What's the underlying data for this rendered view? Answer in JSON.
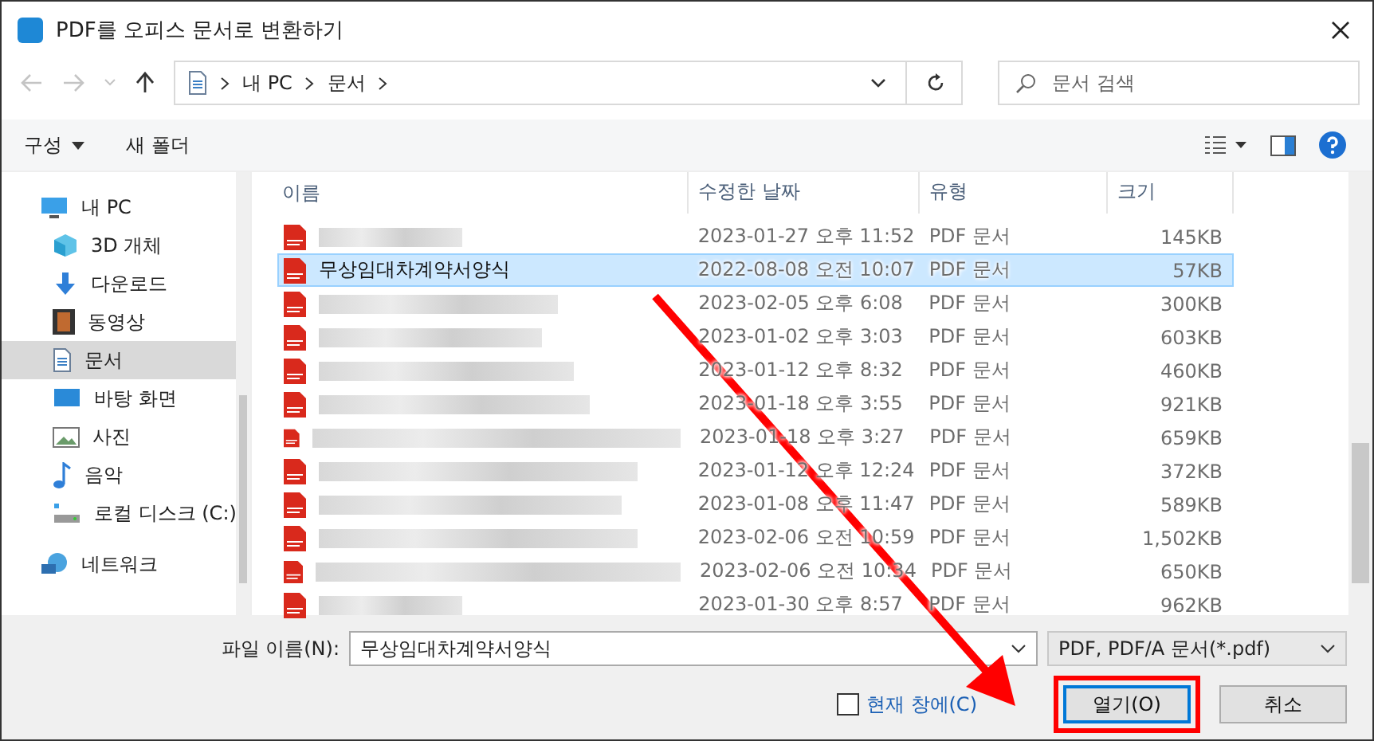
{
  "window": {
    "title": "PDF를 오피스 문서로 변환하기"
  },
  "nav": {
    "path": [
      "내 PC",
      "문서"
    ],
    "search_placeholder": "문서 검색"
  },
  "toolbar": {
    "organize": "구성",
    "new_folder": "새 폴더"
  },
  "sidebar": {
    "items": [
      {
        "label": "내 PC",
        "kind": "pc",
        "selected": false,
        "children": [
          {
            "label": "3D 개체",
            "kind": "cube",
            "selected": false
          },
          {
            "label": "다운로드",
            "kind": "download",
            "selected": false
          },
          {
            "label": "동영상",
            "kind": "video",
            "selected": false
          },
          {
            "label": "문서",
            "kind": "doc",
            "selected": true
          },
          {
            "label": "바탕 화면",
            "kind": "desktop",
            "selected": false
          },
          {
            "label": "사진",
            "kind": "photo",
            "selected": false
          },
          {
            "label": "음악",
            "kind": "music",
            "selected": false
          },
          {
            "label": "로컬 디스크 (C:)",
            "kind": "disk",
            "selected": false
          }
        ]
      },
      {
        "label": "네트워크",
        "kind": "network",
        "selected": false
      }
    ]
  },
  "table": {
    "columns": [
      "이름",
      "수정한 날짜",
      "유형",
      "크기"
    ],
    "rows": [
      {
        "date": "2023-01-27 오후 11:52",
        "type": "PDF 문서",
        "size": "145KB",
        "selected": false
      },
      {
        "name": "무상임대차계약서양식",
        "date": "2022-08-08 오전 10:07",
        "type": "PDF 문서",
        "size": "57KB",
        "selected": true
      },
      {
        "date": "2023-02-05 오후 6:08",
        "type": "PDF 문서",
        "size": "300KB",
        "selected": false
      },
      {
        "date": "2023-01-02 오후 3:03",
        "type": "PDF 문서",
        "size": "603KB",
        "selected": false
      },
      {
        "date": "2023-01-12 오후 8:32",
        "type": "PDF 문서",
        "size": "460KB",
        "selected": false
      },
      {
        "date": "2023-01-18 오후 3:55",
        "type": "PDF 문서",
        "size": "921KB",
        "selected": false
      },
      {
        "date": "2023-01-18 오후 3:27",
        "type": "PDF 문서",
        "size": "659KB",
        "selected": false
      },
      {
        "date": "2023-01-12 오후 12:24",
        "type": "PDF 문서",
        "size": "372KB",
        "selected": false
      },
      {
        "date": "2023-01-08 오후 11:47",
        "type": "PDF 문서",
        "size": "589KB",
        "selected": false
      },
      {
        "date": "2023-02-06 오전 10:59",
        "type": "PDF 문서",
        "size": "1,502KB",
        "selected": false
      },
      {
        "date": "2023-02-06 오전 10:34",
        "type": "PDF 문서",
        "size": "650KB",
        "selected": false
      },
      {
        "date": "2023-01-30 오후 8:57",
        "type": "PDF 문서",
        "size": "962KB",
        "selected": false
      }
    ]
  },
  "footer": {
    "filename_label": "파일 이름(N):",
    "filename": "무상임대차계약서양식",
    "filetype": "PDF, PDF/A 문서(*.pdf)",
    "current_window": {
      "label": "현재 창에(C)",
      "checked": false
    },
    "open_button": "열기(O)",
    "cancel_button": "취소"
  },
  "annotation": {
    "arrow": true,
    "highlight_open": true
  }
}
